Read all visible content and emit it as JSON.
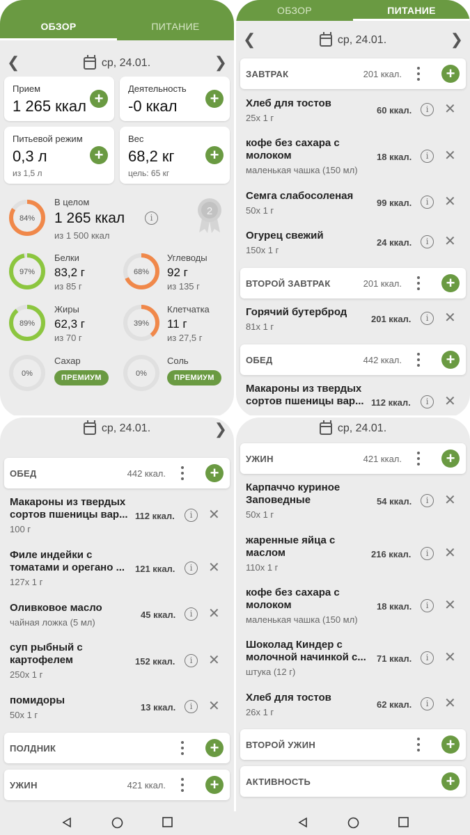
{
  "tabs": {
    "overview": "ОБЗОР",
    "nutrition": "ПИТАНИЕ"
  },
  "date": "ср, 24.01.",
  "overview": {
    "intake": {
      "label": "Прием",
      "value": "1 265 ккал"
    },
    "activity": {
      "label": "Деятельность",
      "value": "-0 ккал"
    },
    "water": {
      "label": "Питьевой режим",
      "value": "0,3 л",
      "sub": "из 1,5 л"
    },
    "weight": {
      "label": "Вес",
      "value": "68,2 кг",
      "sub": "цель: 65 кг"
    },
    "total": {
      "label": "В целом",
      "value": "1 265 ккал",
      "sub": "из 1 500 ккал",
      "pct": "84%",
      "fraction": 0.84
    },
    "medal_number": "2",
    "protein": {
      "label": "Белки",
      "value": "83,2 г",
      "sub": "из 85 г",
      "pct": "97%",
      "fraction": 0.97
    },
    "carbs": {
      "label": "Углеводы",
      "value": "92 г",
      "sub": "из 135 г",
      "pct": "68%",
      "fraction": 0.68
    },
    "fat": {
      "label": "Жиры",
      "value": "62,3 г",
      "sub": "из 70 г",
      "pct": "89%",
      "fraction": 0.89
    },
    "fiber": {
      "label": "Клетчатка",
      "value": "11 г",
      "sub": "из 27,5 г",
      "pct": "39%",
      "fraction": 0.39
    },
    "sugar": {
      "label": "Сахар",
      "pct": "0%",
      "button": "ПРЕМИУМ"
    },
    "salt": {
      "label": "Соль",
      "pct": "0%",
      "button": "ПРЕМИУМ"
    }
  },
  "colors": {
    "accent": "#6a9a42",
    "orange": "#f0884a",
    "green_ring": "#8cc63f",
    "ring_track": "#e0e0e0"
  },
  "p2": {
    "breakfast": {
      "name": "ЗАВТРАК",
      "kcal": "201 ккал."
    },
    "breakfast_items": [
      {
        "name": "Хлеб для тостов",
        "sub": "25x 1 г",
        "kcal": "60 ккал."
      },
      {
        "name": "кофе без сахара с молоком",
        "sub": "маленькая чашка (150 мл)",
        "kcal": "18 ккал."
      },
      {
        "name": "Семга слабосоленая",
        "sub": "50x 1 г",
        "kcal": "99 ккал."
      },
      {
        "name": "Огурец свежий",
        "sub": "150x 1 г",
        "kcal": "24 ккал."
      }
    ],
    "second_breakfast": {
      "name": "ВТОРОЙ ЗАВТРАК",
      "kcal": "201 ккал."
    },
    "second_breakfast_items": [
      {
        "name": "Горячий бутерброд",
        "sub": "81x 1 г",
        "kcal": "201 ккал."
      }
    ],
    "lunch": {
      "name": "ОБЕД",
      "kcal": "442 ккал."
    },
    "lunch_items": [
      {
        "name": "Макароны из твердых сортов пшеницы вар...",
        "sub": "",
        "kcal": "112 ккал."
      }
    ]
  },
  "p3": {
    "lunch": {
      "name": "ОБЕД",
      "kcal": "442 ккал."
    },
    "lunch_items": [
      {
        "name": "Макароны из твердых сортов пшеницы вар...",
        "sub": "100 г",
        "kcal": "112 ккал."
      },
      {
        "name": "Филе индейки с томатами и орегано ...",
        "sub": "127x 1 г",
        "kcal": "121 ккал."
      },
      {
        "name": "Оливковое масло",
        "sub": "чайная ложка (5 мл)",
        "kcal": "45 ккал."
      },
      {
        "name": "суп рыбный с картофелем",
        "sub": "250x 1 г",
        "kcal": "152 ккал."
      },
      {
        "name": "помидоры",
        "sub": "50x 1 г",
        "kcal": "13 ккал."
      }
    ],
    "snack": {
      "name": "ПОЛДНИК"
    },
    "dinner": {
      "name": "УЖИН",
      "kcal": "421 ккал."
    }
  },
  "p4": {
    "dinner": {
      "name": "УЖИН",
      "kcal": "421 ккал."
    },
    "dinner_items": [
      {
        "name": "Карпаччо куриное Заповедные",
        "sub": "50x 1 г",
        "kcal": "54 ккал."
      },
      {
        "name": "жаренные яйца с маслом",
        "sub": "110x 1 г",
        "kcal": "216 ккал."
      },
      {
        "name": "кофе без сахара с молоком",
        "sub": "маленькая чашка (150 мл)",
        "kcal": "18 ккал."
      },
      {
        "name": "Шоколад Киндер с молочной начинкой с...",
        "sub": "штука (12 г)",
        "kcal": "71 ккал."
      },
      {
        "name": "Хлеб для тостов",
        "sub": "26x 1 г",
        "kcal": "62 ккал."
      }
    ],
    "second_dinner": {
      "name": "ВТОРОЙ УЖИН"
    },
    "activity": {
      "name": "АКТИВНОСТЬ"
    }
  }
}
